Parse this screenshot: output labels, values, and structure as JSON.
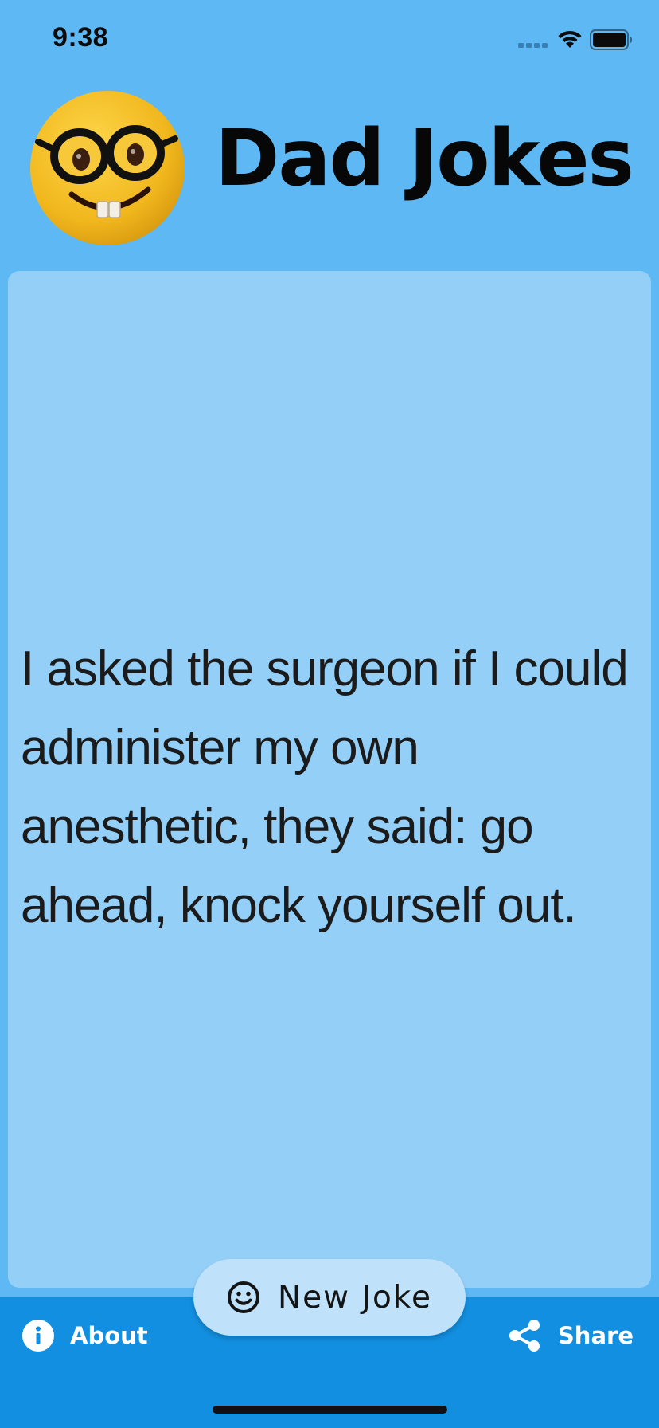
{
  "status_bar": {
    "time": "9:38"
  },
  "header": {
    "title": "Dad Jokes",
    "logo_icon": "nerd-face-emoji"
  },
  "joke": {
    "text": "I asked the surgeon if I could administer my own anesthetic, they said: go ahead, knock yourself out."
  },
  "bottom_bar": {
    "about_label": "About",
    "about_icon": "info-icon",
    "share_label": "Share",
    "share_icon": "share-icon",
    "new_joke_label": "New Joke",
    "new_joke_icon": "smiley-icon"
  },
  "colors": {
    "background": "#5db8f4",
    "card": "#94cff7",
    "bottom_bar": "#128fe0",
    "new_joke_button": "#bfe1fa"
  }
}
